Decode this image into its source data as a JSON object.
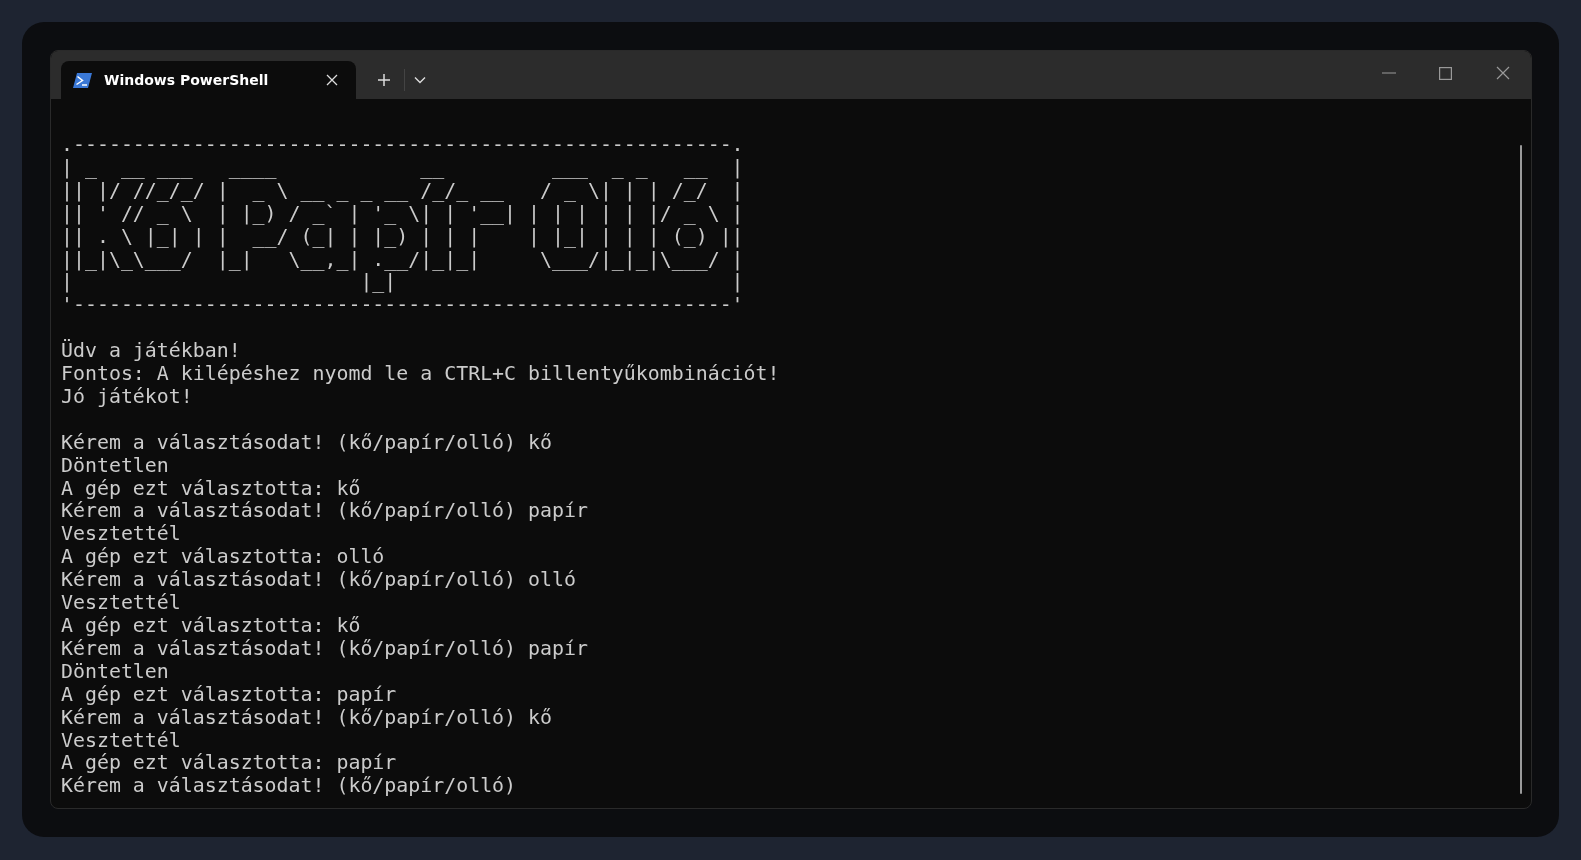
{
  "window": {
    "tabs": [
      {
        "title": "Windows PowerShell",
        "selected": true
      }
    ]
  },
  "terminal": {
    "banner": [
      ".-------------------------------------------------------.",
      "| _  __ ___   ____            __         ___  _ _   __  |",
      "|| |/ //_/_/ |  _ \\ __ _ _ __ /_/_ __   / _ \\| | | /_/  |",
      "|| ' // _ \\  | |_) / _` | '_ \\| | '__| | | | | | |/ _ \\ |",
      "|| . \\ |_| | |  __/ (_| | |_) | | |    | |_| | | | (_) ||",
      "||_|\\_\\___/  |_|   \\__,_| .__/|_|_|     \\___/|_|_|\\___/ |",
      "|                        |_|                            |",
      "'-------------------------------------------------------'"
    ],
    "blocks": [
      [
        "Üdv a játékban!",
        "Fontos: A kilépéshez nyomd le a CTRL+C billentyűkombinációt!",
        "Jó játékot!"
      ],
      [
        "Kérem a választásodat! (kő/papír/olló) kő",
        "Döntetlen",
        "A gép ezt választotta: kő",
        "Kérem a választásodat! (kő/papír/olló) papír",
        "Vesztettél",
        "A gép ezt választotta: olló",
        "Kérem a választásodat! (kő/papír/olló) olló",
        "Vesztettél",
        "A gép ezt választotta: kő",
        "Kérem a választásodat! (kő/papír/olló) papír",
        "Döntetlen",
        "A gép ezt választotta: papír",
        "Kérem a választásodat! (kő/papír/olló) kő",
        "Vesztettél",
        "A gép ezt választotta: papír",
        "Kérem a választásodat! (kő/papír/olló)"
      ]
    ]
  }
}
